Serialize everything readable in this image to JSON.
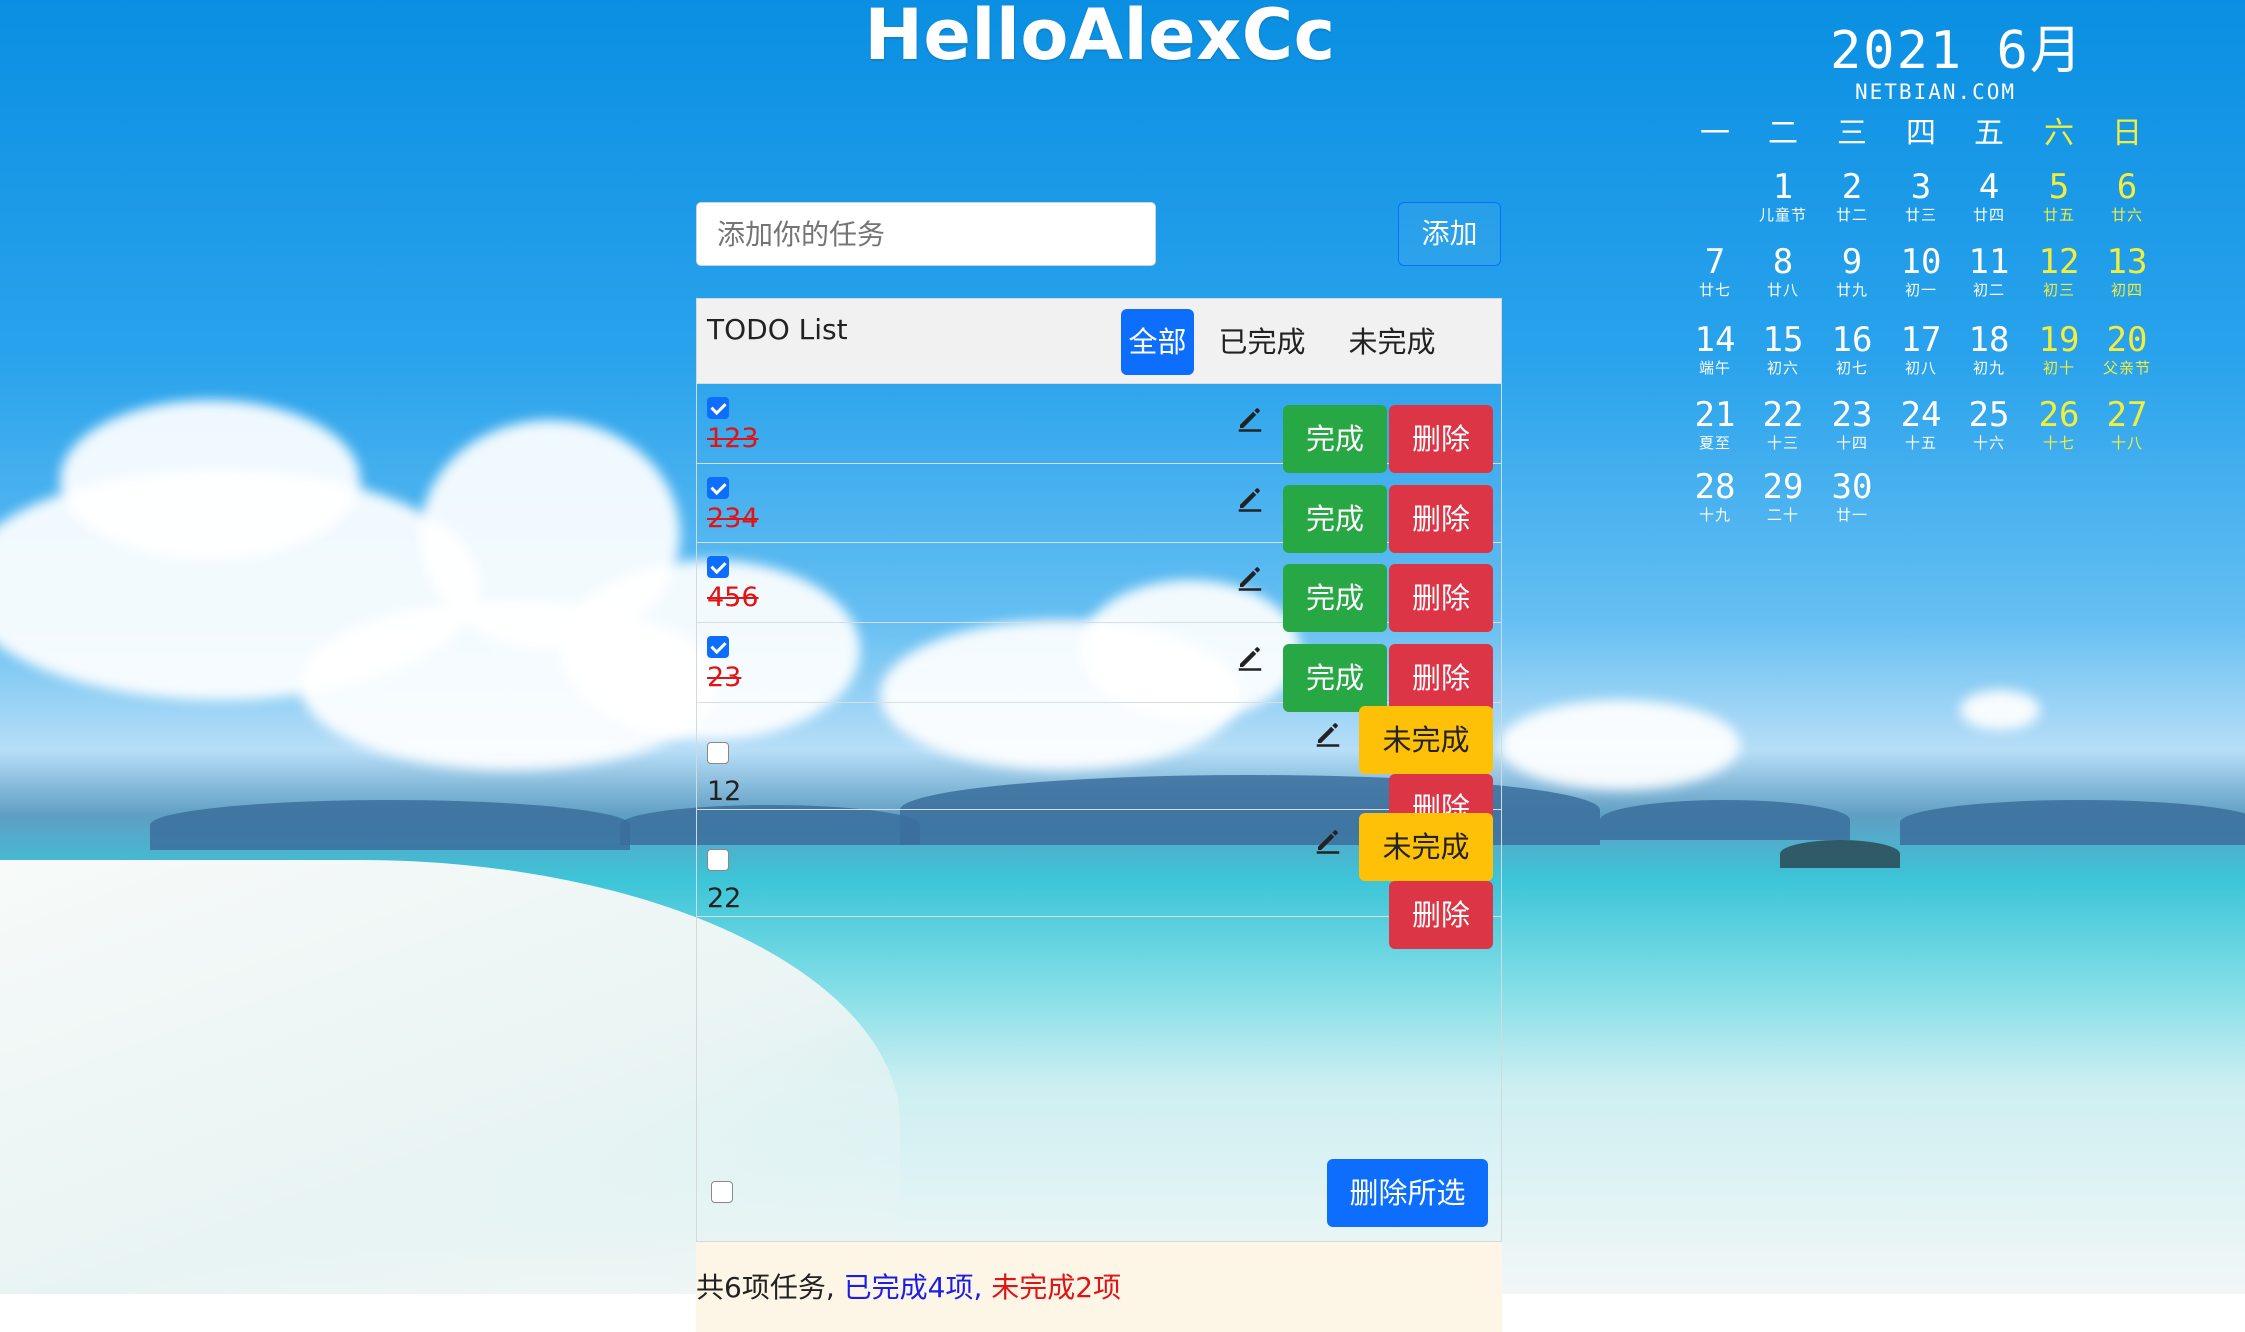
{
  "header": {
    "title": "HelloAlexCc"
  },
  "calendar": {
    "month_label": "2021  6月",
    "site": "NETBIAN.COM",
    "weekdays": [
      "一",
      "二",
      "三",
      "四",
      "五",
      "六",
      "日"
    ],
    "weeks": [
      [
        [
          "",
          ""
        ],
        [
          "1",
          "儿童节"
        ],
        [
          "2",
          "廿二"
        ],
        [
          "3",
          "廿三"
        ],
        [
          "4",
          "廿四"
        ],
        [
          "5",
          "廿五"
        ],
        [
          "6",
          "廿六"
        ]
      ],
      [
        [
          "7",
          "廿七"
        ],
        [
          "8",
          "廿八"
        ],
        [
          "9",
          "廿九"
        ],
        [
          "10",
          "初一"
        ],
        [
          "11",
          "初二"
        ],
        [
          "12",
          "初三"
        ],
        [
          "13",
          "初四"
        ]
      ],
      [
        [
          "14",
          "端午"
        ],
        [
          "15",
          "初六"
        ],
        [
          "16",
          "初七"
        ],
        [
          "17",
          "初八"
        ],
        [
          "18",
          "初九"
        ],
        [
          "19",
          "初十"
        ],
        [
          "20",
          "父亲节"
        ]
      ],
      [
        [
          "21",
          "夏至"
        ],
        [
          "22",
          "十三"
        ],
        [
          "23",
          "十四"
        ],
        [
          "24",
          "十五"
        ],
        [
          "25",
          "十六"
        ],
        [
          "26",
          "十七"
        ],
        [
          "27",
          "十八"
        ]
      ],
      [
        [
          "28",
          "十九"
        ],
        [
          "29",
          "二十"
        ],
        [
          "30",
          "廿一"
        ]
      ]
    ]
  },
  "add": {
    "placeholder": "添加你的任务",
    "button": "添加"
  },
  "panel": {
    "title": "TODO List",
    "filters": [
      "全部",
      "已完成",
      "未完成"
    ],
    "active_filter": "全部"
  },
  "tasks": [
    {
      "text": "123",
      "checked": true,
      "state_button": "完成",
      "delete_button": "删除"
    },
    {
      "text": "234",
      "checked": true,
      "state_button": "完成",
      "delete_button": "删除"
    },
    {
      "text": "456",
      "checked": true,
      "state_button": "完成",
      "delete_button": "删除"
    },
    {
      "text": "23",
      "checked": true,
      "state_button": "完成",
      "delete_button": "删除"
    },
    {
      "text": "12",
      "checked": false,
      "state_button": "未完成",
      "delete_button": "删除"
    },
    {
      "text": "22",
      "checked": false,
      "state_button": "未完成",
      "delete_button": "删除"
    }
  ],
  "bulk": {
    "delete_selected": "删除所选"
  },
  "footer": {
    "total": "共6项任务,",
    "done": "已完成4项,",
    "undone": "未完成2项"
  },
  "colors": {
    "primary": "#0d6efd",
    "success": "#28a745",
    "danger": "#dc3545",
    "warning": "#ffc107",
    "done_text": "#e01414"
  }
}
